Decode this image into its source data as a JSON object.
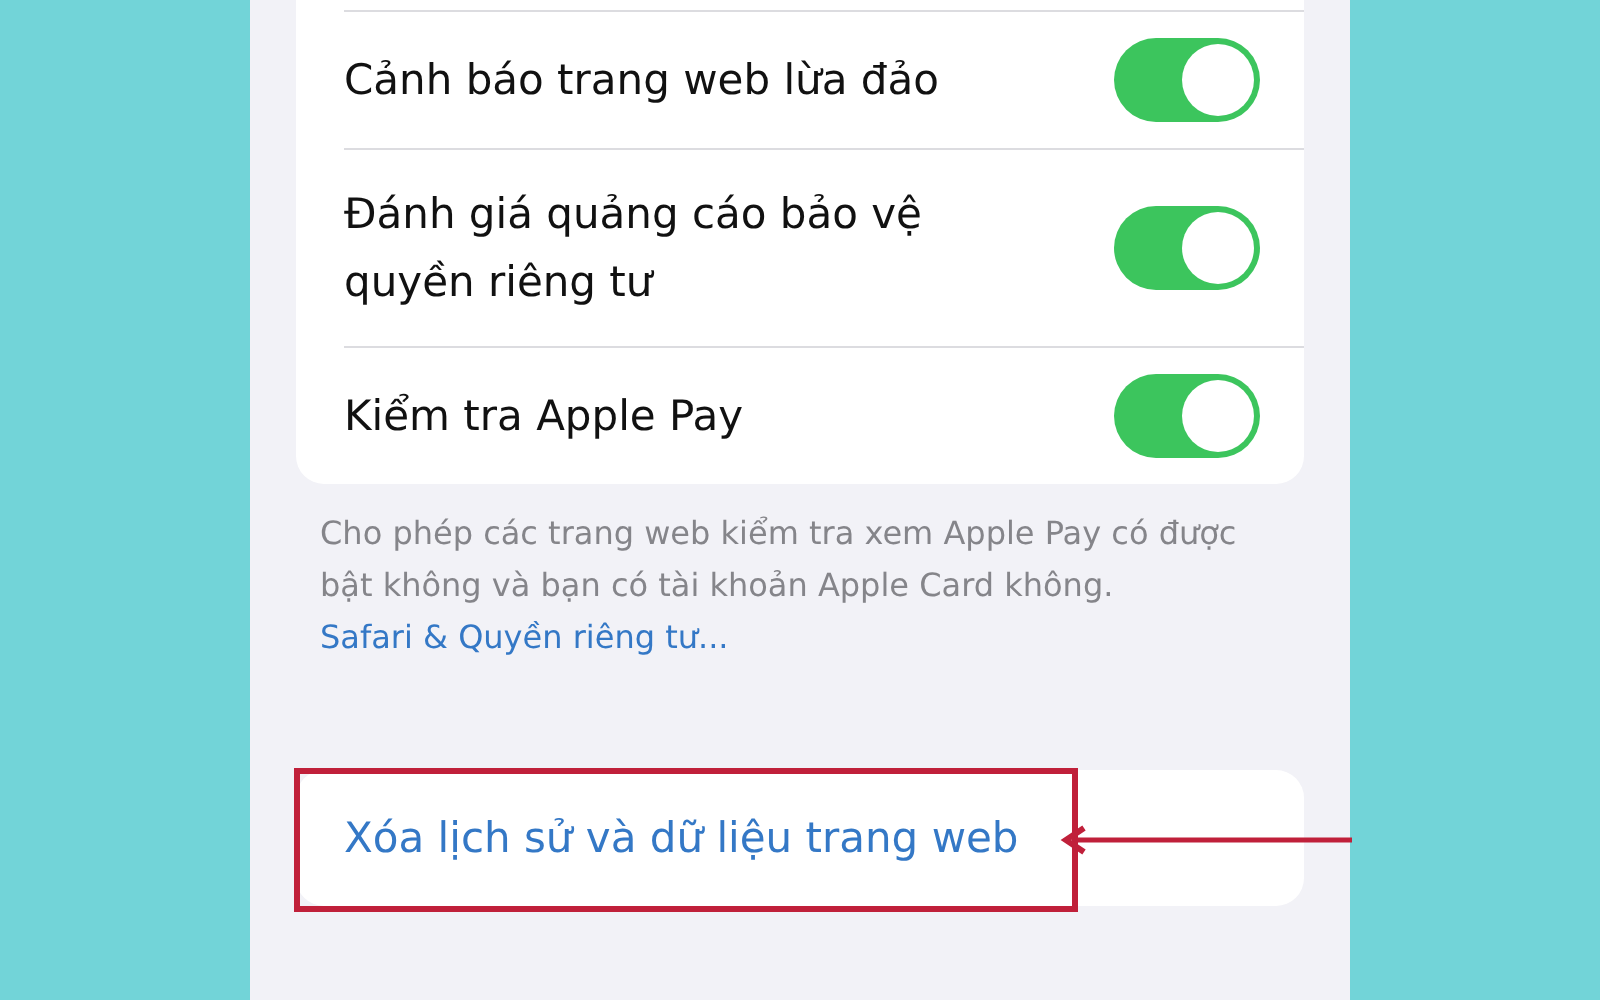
{
  "settings": [
    {
      "label": "Cảnh báo trang web lừa đảo",
      "on": true
    },
    {
      "label": "Đánh giá quảng cáo bảo vệ quyền riêng tư",
      "on": true
    },
    {
      "label": "Kiểm tra Apple Pay",
      "on": true
    }
  ],
  "footer": {
    "text": "Cho phép các trang web kiểm tra xem Apple Pay có được bật không và bạn có tài khoản Apple Card không.",
    "link": "Safari & Quyền riêng tư..."
  },
  "action": {
    "label": "Xóa lịch sử và dữ liệu trang web",
    "highlighted": true
  }
}
